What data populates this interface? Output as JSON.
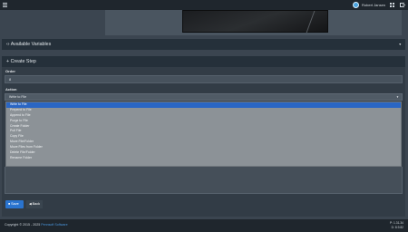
{
  "header": {
    "user_name": "Robert Jansen"
  },
  "sections": {
    "available_variables": "‹› Available Variables",
    "create_step": "+ Create Step",
    "collapse_caret": "▼"
  },
  "form": {
    "order_label": "Order",
    "order_value": "8",
    "action_label": "Action",
    "action_value": "Write to File",
    "action_options": [
      "Write to File",
      "Prepend to File",
      "Append to File",
      "Purge to File",
      "Create Folder",
      "Pull File",
      "Copy File",
      "Move File/Folder",
      "Move Files from Folder",
      "Delete File/Folder",
      "Rename Folder"
    ],
    "selected_index": 0
  },
  "buttons": {
    "save_label": "Save",
    "back_label": "Back"
  },
  "footer": {
    "copyright_prefix": "Copyright © 2015 - 2025 ",
    "company": "Pennsoft Software",
    "version_line1": "P: 1.31.34",
    "version_line2": "D: 8.9.82"
  }
}
